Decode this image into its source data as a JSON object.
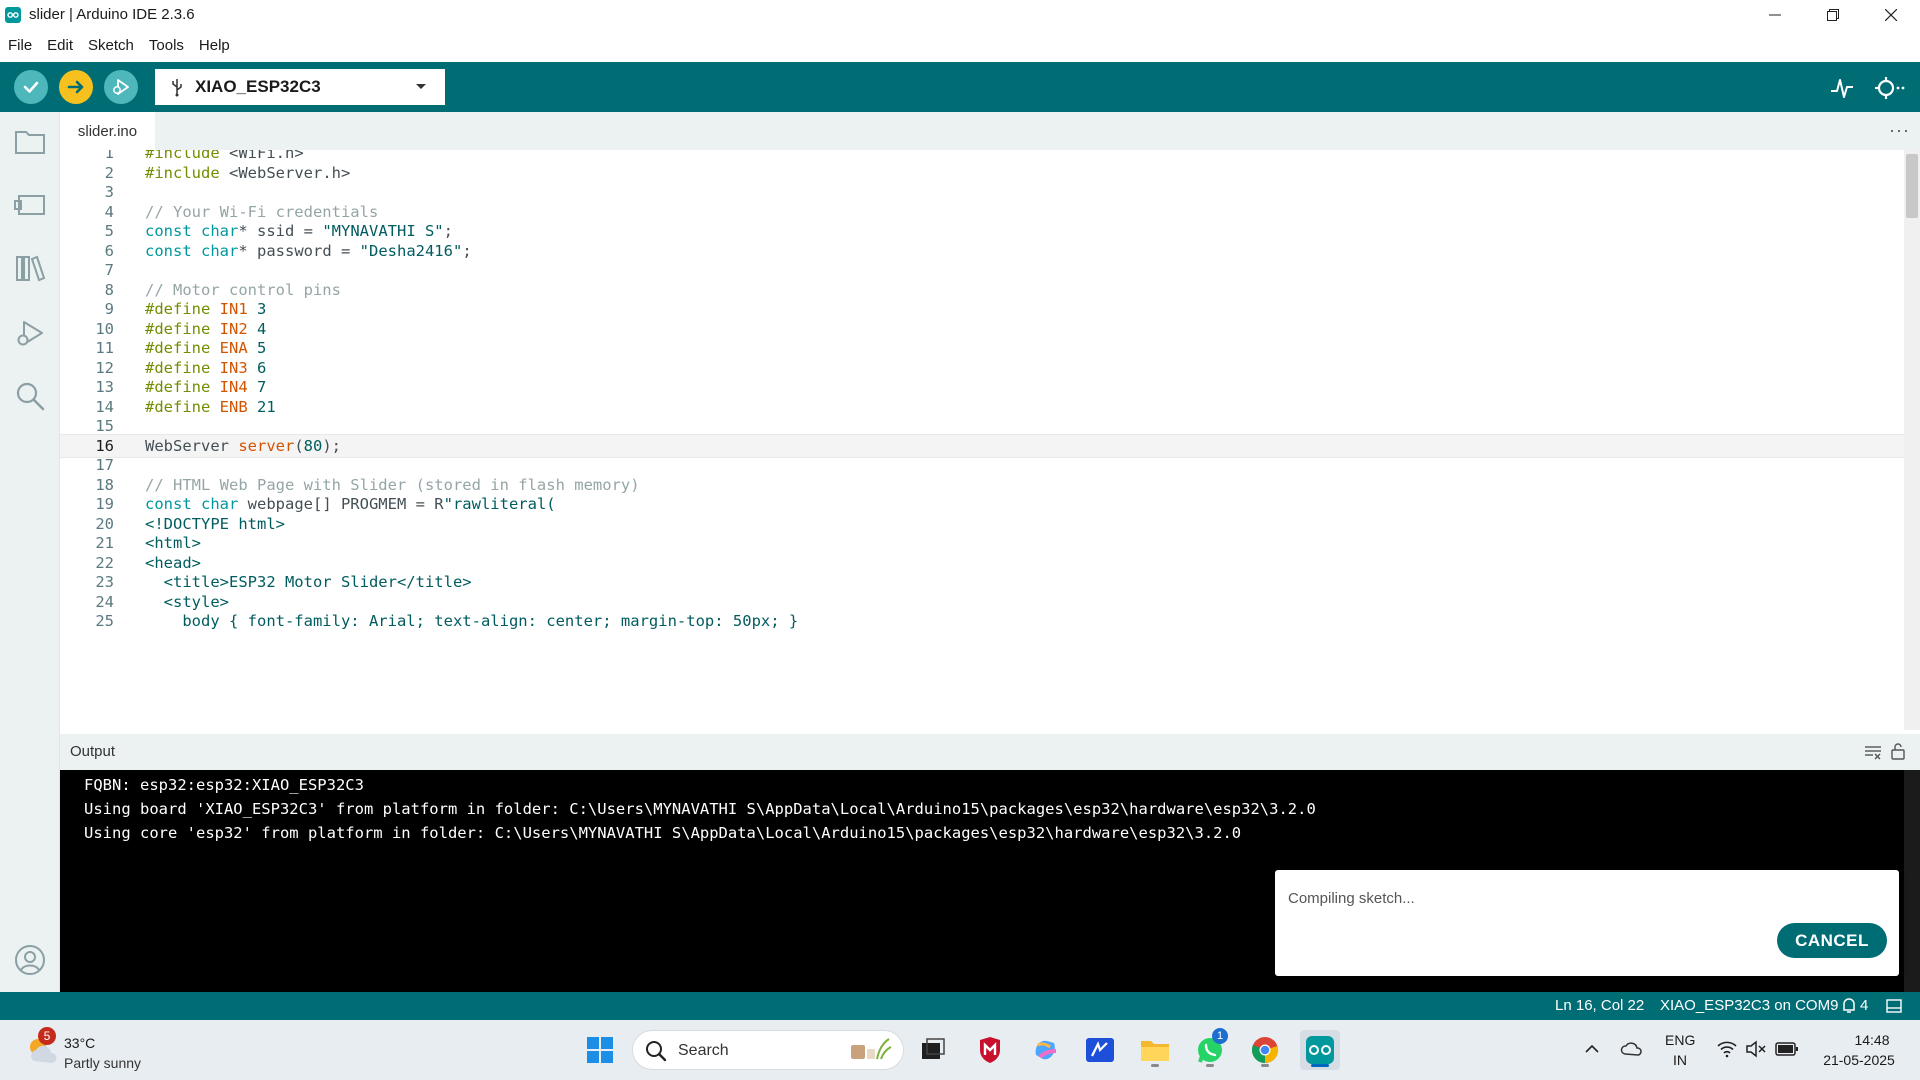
{
  "window": {
    "title": "slider | Arduino IDE 2.3.6",
    "controls": {
      "minimize": "minimize",
      "maximize": "restore",
      "close": "close"
    }
  },
  "menu": [
    "File",
    "Edit",
    "Sketch",
    "Tools",
    "Help"
  ],
  "toolbar": {
    "verify": "verify",
    "upload": "upload",
    "debug": "debug",
    "board": "XIAO_ESP32C3",
    "serial_plotter": "serial-plotter",
    "serial_monitor": "serial-monitor",
    "accent": "#006d75"
  },
  "sidebar": [
    "sketchbook",
    "boards-manager",
    "library-manager",
    "debug",
    "search",
    "profile"
  ],
  "tabs": [
    {
      "label": "slider.ino"
    }
  ],
  "editor": {
    "current_line": 16,
    "lines": [
      {
        "n": "1",
        "tokens": [
          [
            "pp",
            "#include "
          ],
          [
            "tag",
            "<WiFi.h>"
          ]
        ]
      },
      {
        "n": "2",
        "tokens": [
          [
            "pp",
            "#include "
          ],
          [
            "tag",
            "<WebServer.h>"
          ]
        ]
      },
      {
        "n": "3",
        "tokens": []
      },
      {
        "n": "4",
        "tokens": [
          [
            "cm",
            "// Your Wi-Fi credentials"
          ]
        ]
      },
      {
        "n": "5",
        "tokens": [
          [
            "kw",
            "const "
          ],
          [
            "kw",
            "char"
          ],
          [
            "tag",
            "* ssid = "
          ],
          [
            "str",
            "\"MYNAVATHI S\""
          ],
          [
            "tag",
            ";"
          ]
        ]
      },
      {
        "n": "6",
        "tokens": [
          [
            "kw",
            "const "
          ],
          [
            "kw",
            "char"
          ],
          [
            "tag",
            "* password = "
          ],
          [
            "str",
            "\"Desha2416\""
          ],
          [
            "tag",
            ";"
          ]
        ]
      },
      {
        "n": "7",
        "tokens": []
      },
      {
        "n": "8",
        "tokens": [
          [
            "cm",
            "// Motor control pins"
          ]
        ]
      },
      {
        "n": "9",
        "tokens": [
          [
            "pp",
            "#define "
          ],
          [
            "fn",
            "IN1"
          ],
          [
            "num",
            " 3"
          ]
        ]
      },
      {
        "n": "10",
        "tokens": [
          [
            "pp",
            "#define "
          ],
          [
            "fn",
            "IN2"
          ],
          [
            "num",
            " 4"
          ]
        ]
      },
      {
        "n": "11",
        "tokens": [
          [
            "pp",
            "#define "
          ],
          [
            "fn",
            "ENA"
          ],
          [
            "num",
            " 5"
          ]
        ]
      },
      {
        "n": "12",
        "tokens": [
          [
            "pp",
            "#define "
          ],
          [
            "fn",
            "IN3"
          ],
          [
            "num",
            " 6"
          ]
        ]
      },
      {
        "n": "13",
        "tokens": [
          [
            "pp",
            "#define "
          ],
          [
            "fn",
            "IN4"
          ],
          [
            "num",
            " 7"
          ]
        ]
      },
      {
        "n": "14",
        "tokens": [
          [
            "pp",
            "#define "
          ],
          [
            "fn",
            "ENB"
          ],
          [
            "num",
            " 21"
          ]
        ]
      },
      {
        "n": "15",
        "tokens": []
      },
      {
        "n": "16",
        "tokens": [
          [
            "tag",
            "WebServer "
          ],
          [
            "fn",
            "server"
          ],
          [
            "tag",
            "("
          ],
          [
            "num",
            "80"
          ],
          [
            "tag",
            ");"
          ]
        ]
      },
      {
        "n": "17",
        "tokens": []
      },
      {
        "n": "18",
        "tokens": [
          [
            "cm",
            "// HTML Web Page with Slider (stored in flash memory)"
          ]
        ]
      },
      {
        "n": "19",
        "tokens": [
          [
            "kw",
            "const "
          ],
          [
            "kw",
            "char"
          ],
          [
            "tag",
            " webpage[] PROGMEM = R"
          ],
          [
            "str",
            "\"rawliteral("
          ]
        ]
      },
      {
        "n": "20",
        "tokens": [
          [
            "str",
            "<!DOCTYPE html>"
          ]
        ]
      },
      {
        "n": "21",
        "tokens": [
          [
            "str",
            "<html>"
          ]
        ]
      },
      {
        "n": "22",
        "tokens": [
          [
            "str",
            "<head>"
          ]
        ]
      },
      {
        "n": "23",
        "tokens": [
          [
            "str",
            "  <title>ESP32 Motor Slider</title>"
          ]
        ]
      },
      {
        "n": "24",
        "tokens": [
          [
            "str",
            "  <style>"
          ]
        ]
      },
      {
        "n": "25",
        "tokens": [
          [
            "str",
            "    body { font-family: Arial; text-align: center; margin-top: 50px; }"
          ]
        ]
      }
    ]
  },
  "output": {
    "title": "Output",
    "lines": [
      "FQBN: esp32:esp32:XIAO_ESP32C3",
      "Using board 'XIAO_ESP32C3' from platform in folder: C:\\Users\\MYNAVATHI S\\AppData\\Local\\Arduino15\\packages\\esp32\\hardware\\esp32\\3.2.0",
      "Using core 'esp32' from platform in folder: C:\\Users\\MYNAVATHI S\\AppData\\Local\\Arduino15\\packages\\esp32\\hardware\\esp32\\3.2.0"
    ]
  },
  "notification": {
    "text": "Compiling sketch...",
    "cancel": "CANCEL"
  },
  "status": {
    "position": "Ln 16, Col 22",
    "board_port": "XIAO_ESP32C3 on COM9",
    "notifications": "4"
  },
  "taskbar": {
    "weather_badge": "5",
    "temperature": "33°C",
    "condition": "Partly sunny",
    "search": "Search",
    "whatsapp_badge": "1",
    "language_top": "ENG",
    "language_bottom": "IN",
    "time": "14:48",
    "date": "21-05-2025"
  }
}
